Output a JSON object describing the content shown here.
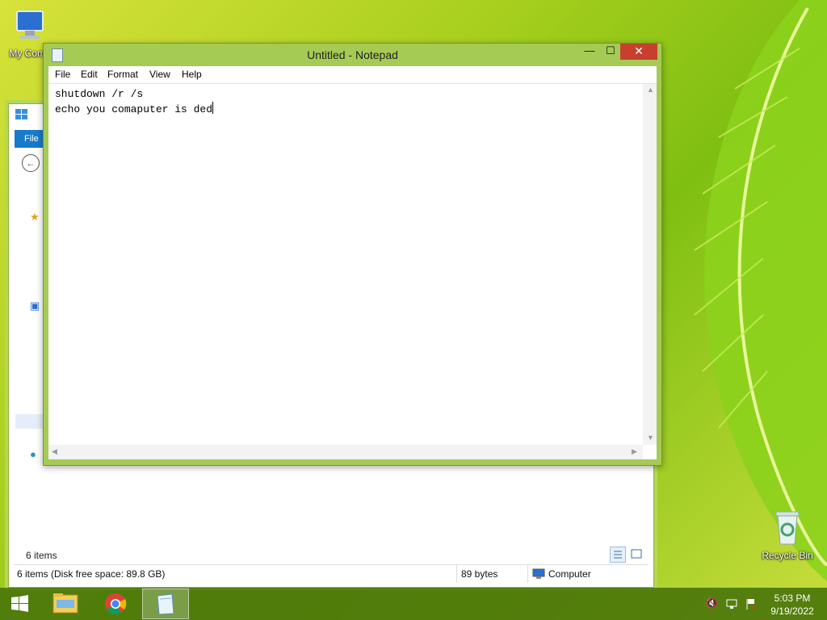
{
  "desktop": {
    "icons": [
      {
        "label": "My Comp"
      },
      {
        "label": "Recycle Bin"
      }
    ]
  },
  "explorer": {
    "ribbon_tab": "File",
    "items_count": "6 items",
    "status": {
      "summary": "6 items (Disk free space: 89.8 GB)",
      "size": "89 bytes",
      "location": "Computer"
    }
  },
  "notepad": {
    "title": "Untitled - Notepad",
    "buttons": {
      "minimize": "—",
      "maximize": "☐",
      "close": "✕"
    },
    "menu": [
      "File",
      "Edit",
      "Format",
      "View",
      "Help"
    ],
    "content_lines": [
      "shutdown /r /s",
      "echo you comaputer is ded"
    ]
  },
  "taskbar": {
    "clock": {
      "time": "5:03 PM",
      "date": "9/19/2022"
    },
    "pinned": [
      {
        "name": "file-explorer"
      },
      {
        "name": "chrome"
      },
      {
        "name": "notepad"
      }
    ]
  },
  "colors": {
    "accent_blue": "#1979ca",
    "close_red": "#c7402d",
    "window_frame": "#a5cb55",
    "taskbar": "#4b760a"
  }
}
